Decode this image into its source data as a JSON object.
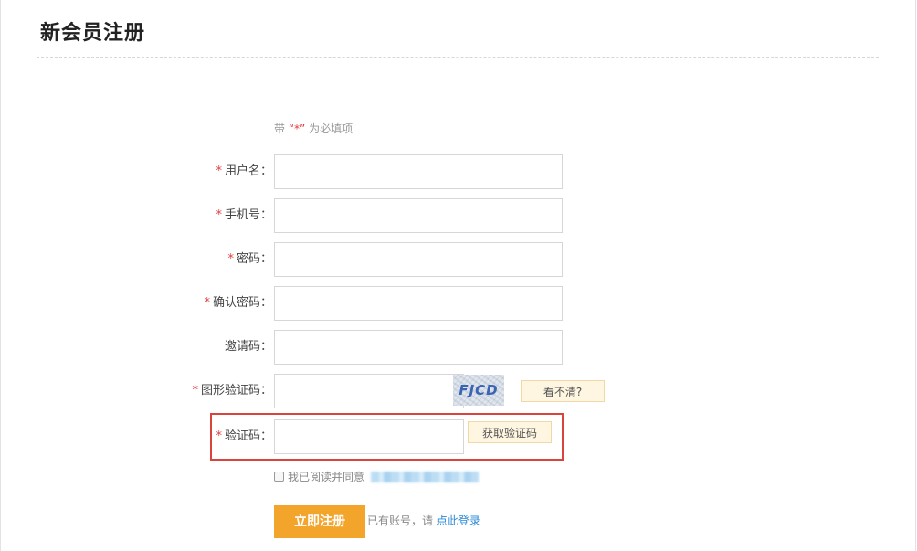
{
  "page": {
    "title": "新会员注册",
    "required_note": {
      "prefix": "带",
      "star": "“*”",
      "suffix": " 为必填项"
    }
  },
  "form": {
    "required_marker": "*",
    "username": {
      "label": "用户名：",
      "value": "",
      "placeholder": ""
    },
    "phone": {
      "label": "手机号：",
      "value": "",
      "placeholder": ""
    },
    "password": {
      "label": "密码：",
      "value": "",
      "placeholder": ""
    },
    "confirm_password": {
      "label": "确认密码：",
      "value": "",
      "placeholder": ""
    },
    "invite_code": {
      "label": "邀请码：",
      "value": "",
      "placeholder": ""
    },
    "image_captcha": {
      "label": "图形验证码：",
      "value": "",
      "captcha_text": "FJCD",
      "refresh_label": "看不清?"
    },
    "sms_code": {
      "label": "验证码：",
      "value": "",
      "get_code_label": "获取验证码"
    },
    "agreement": {
      "text": "我已阅读并同意",
      "checked": false
    },
    "submit_label": "立即注册",
    "login_hint": "已有账号，请 ",
    "login_link": "点此登录"
  },
  "colors": {
    "accent": "#f3a42a",
    "required": "#e4393c",
    "link": "#2a88d5",
    "highlight": "#d9443d"
  }
}
